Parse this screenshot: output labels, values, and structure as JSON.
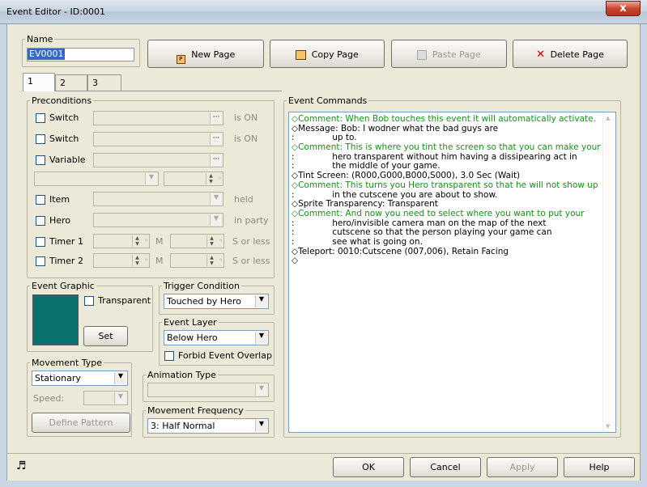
{
  "window": {
    "title": "Event Editor - ID:0001",
    "close_glyph": "x"
  },
  "name_group": {
    "legend": "Name",
    "value": "EV0001"
  },
  "page_buttons": {
    "new": "New Page",
    "copy": "Copy Page",
    "paste": "Paste Page",
    "delete": "Delete Page"
  },
  "tabs": [
    "1",
    "2",
    "3"
  ],
  "preconditions": {
    "legend": "Preconditions",
    "switch1": {
      "label": "Switch",
      "suffix": "is ON"
    },
    "switch2": {
      "label": "Switch",
      "suffix": "is ON"
    },
    "variable": {
      "label": "Variable"
    },
    "item": {
      "label": "Item",
      "suffix": "held"
    },
    "hero": {
      "label": "Hero",
      "suffix": "in party"
    },
    "timer1": {
      "label": "Timer 1",
      "unit_m": "M",
      "unit_s": "S or less"
    },
    "timer2": {
      "label": "Timer 2",
      "unit_m": "M",
      "unit_s": "S or less"
    }
  },
  "event_graphic": {
    "legend": "Event Graphic",
    "transparent_label": "Transparent",
    "set_label": "Set",
    "swatch_color": "#0a716c"
  },
  "trigger": {
    "legend": "Trigger Condition",
    "value": "Touched by Hero"
  },
  "layer": {
    "legend": "Event Layer",
    "value": "Below Hero",
    "forbid_label": "Forbid Event Overlap"
  },
  "movement_type": {
    "legend": "Movement Type",
    "value": "Stationary",
    "speed_label": "Speed:",
    "define_label": "Define Pattern"
  },
  "animation": {
    "legend": "Animation Type",
    "value": ""
  },
  "frequency": {
    "legend": "Movement Frequency",
    "value": "3: Half Normal"
  },
  "commands": {
    "legend": "Event Commands",
    "lines": [
      {
        "text": "◇Comment: When Bob touches this event it will automatically activate.",
        "kind": "comment"
      },
      {
        "text": "◇Message: Bob: I wodner what the bad guys are",
        "kind": "normal"
      },
      {
        "text": ":              up to.",
        "kind": "normal"
      },
      {
        "text": "◇Comment: This is where you tint the screen so that you can make your",
        "kind": "comment"
      },
      {
        "text": ":              hero transparent without him having a dissipearing act in",
        "kind": "normal"
      },
      {
        "text": ":              the middle of your game.",
        "kind": "normal"
      },
      {
        "text": "◇Tint Screen: (R000,G000,B000,S000), 3.0 Sec (Wait)",
        "kind": "normal"
      },
      {
        "text": "◇Comment: This turns you Hero transparent so that he will not show up",
        "kind": "comment"
      },
      {
        "text": ":              in the cutscene you are about to show.",
        "kind": "normal"
      },
      {
        "text": "◇Sprite Transparency: Transparent",
        "kind": "normal"
      },
      {
        "text": "◇Comment: And now you need to select where you want to put your",
        "kind": "comment"
      },
      {
        "text": ":              hero/invisible camera man on the map of the next",
        "kind": "normal"
      },
      {
        "text": ":              cutscene so that the person playing your game can",
        "kind": "normal"
      },
      {
        "text": ":              see what is going on.",
        "kind": "normal"
      },
      {
        "text": "◇Teleport: 0010:Cutscene (007,006), Retain Facing",
        "kind": "normal"
      },
      {
        "text": "◇",
        "kind": "normal"
      }
    ]
  },
  "footer": {
    "ok": "OK",
    "cancel": "Cancel",
    "apply": "Apply",
    "help": "Help"
  },
  "colors": {
    "comment": "#1a8f1a",
    "accent": "#0a716c"
  }
}
